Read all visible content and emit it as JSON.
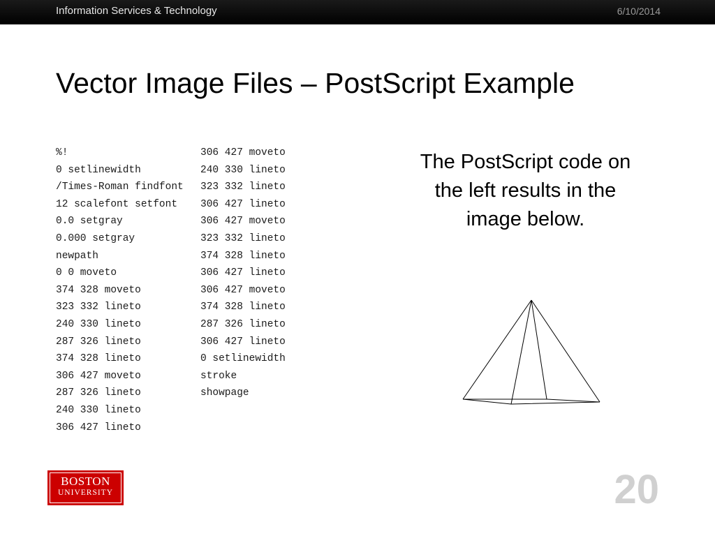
{
  "header": {
    "org": "Information Services & Technology",
    "date": "6/10/2014"
  },
  "title": "Vector Image Files – PostScript Example",
  "code_left": [
    "%!",
    "0 setlinewidth",
    "/Times-Roman findfont",
    "12 scalefont setfont",
    "0.0 setgray",
    "0.000 setgray",
    "newpath",
    "0 0 moveto",
    "374 328 moveto",
    "323 332 lineto",
    "240 330 lineto",
    "287 326 lineto",
    "374 328 lineto",
    "306 427 moveto",
    "287 326 lineto",
    "240 330 lineto",
    "306 427 lineto"
  ],
  "code_right": [
    "306 427 moveto",
    "240 330 lineto",
    "323 332 lineto",
    "306 427 lineto",
    "306 427 moveto",
    "323 332 lineto",
    "374 328 lineto",
    "306 427 lineto",
    "306 427 moveto",
    "374 328 lineto",
    "287 326 lineto",
    "306 427 lineto",
    "0 setlinewidth",
    "stroke",
    "showpage"
  ],
  "description": "The PostScript code on the left results in the image below.",
  "logo": {
    "line1": "BOSTON",
    "line2": "UNIVERSITY",
    "color": "#cc0000"
  },
  "page_number": "20"
}
